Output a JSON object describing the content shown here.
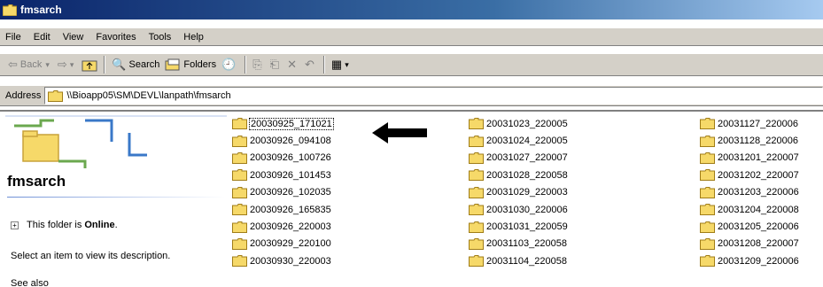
{
  "window": {
    "title": "fmsarch"
  },
  "menu": [
    "File",
    "Edit",
    "View",
    "Favorites",
    "Tools",
    "Help"
  ],
  "toolbar": {
    "back_label": "Back",
    "search_label": "Search",
    "folders_label": "Folders"
  },
  "address": {
    "label": "Address",
    "path": "\\\\Bioapp05\\SM\\DEVL\\lanpath\\fmsarch"
  },
  "left_pane": {
    "title": "fmsarch",
    "online_prefix": "This folder is ",
    "online_status": "Online",
    "online_suffix": ".",
    "select_hint": "Select an item to view its description.",
    "cut_text": "See also"
  },
  "folders": {
    "col1": [
      "20030925_171021",
      "20030926_094108",
      "20030926_100726",
      "20030926_101453",
      "20030926_102035",
      "20030926_165835",
      "20030926_220003",
      "20030929_220100",
      "20030930_220003"
    ],
    "col2": [
      "20031023_220005",
      "20031024_220005",
      "20031027_220007",
      "20031028_220058",
      "20031029_220003",
      "20031030_220006",
      "20031031_220059",
      "20031103_220058",
      "20031104_220058"
    ],
    "col3": [
      "20031127_220006",
      "20031128_220006",
      "20031201_220007",
      "20031202_220007",
      "20031203_220006",
      "20031204_220008",
      "20031205_220006",
      "20031208_220007",
      "20031209_220006"
    ],
    "selected": "20030925_171021"
  },
  "colors": {
    "titlebar": "#0a246a",
    "chrome": "#d4d0c8",
    "folder": "#f6d969"
  }
}
